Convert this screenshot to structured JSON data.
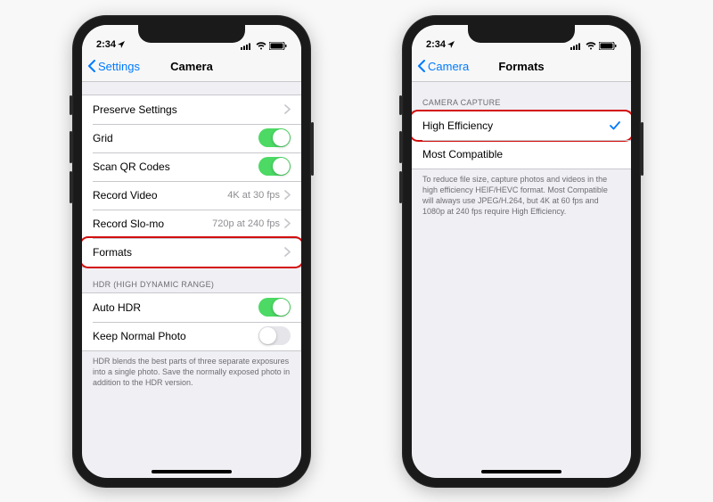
{
  "status": {
    "time": "2:34",
    "location_icon": true
  },
  "left_phone": {
    "back_label": "Settings",
    "title": "Camera",
    "group1": [
      {
        "label": "Preserve Settings",
        "type": "nav"
      },
      {
        "label": "Grid",
        "type": "toggle",
        "on": true
      },
      {
        "label": "Scan QR Codes",
        "type": "toggle",
        "on": true
      },
      {
        "label": "Record Video",
        "type": "nav",
        "detail": "4K at 30 fps"
      },
      {
        "label": "Record Slo-mo",
        "type": "nav",
        "detail": "720p at 240 fps"
      },
      {
        "label": "Formats",
        "type": "nav",
        "highlight": true
      }
    ],
    "section2_header": "HDR (HIGH DYNAMIC RANGE)",
    "group2": [
      {
        "label": "Auto HDR",
        "type": "toggle",
        "on": true
      },
      {
        "label": "Keep Normal Photo",
        "type": "toggle",
        "on": false
      }
    ],
    "footer2": "HDR blends the best parts of three separate exposures into a single photo. Save the normally exposed photo in addition to the HDR version."
  },
  "right_phone": {
    "back_label": "Camera",
    "title": "Formats",
    "section_header": "CAMERA CAPTURE",
    "options": [
      {
        "label": "High Efficiency",
        "checked": true,
        "highlight": true
      },
      {
        "label": "Most Compatible",
        "checked": false
      }
    ],
    "footer": "To reduce file size, capture photos and videos in the high efficiency HEIF/HEVC format. Most Compatible will always use JPEG/H.264, but 4K at 60 fps and 1080p at 240 fps require High Efficiency."
  }
}
